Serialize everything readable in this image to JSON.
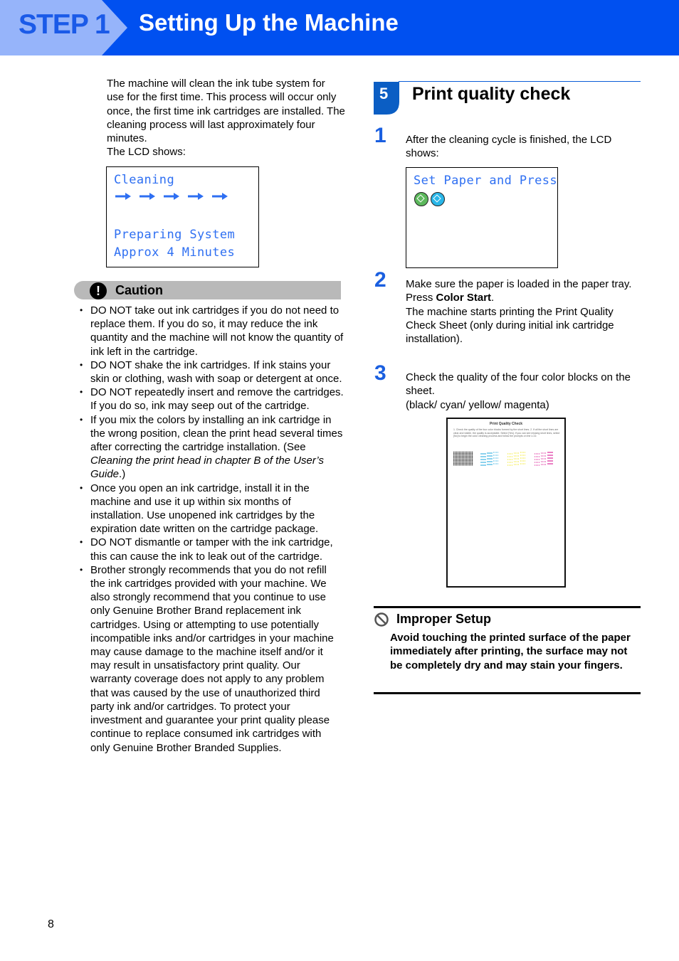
{
  "header": {
    "step_label": "STEP 1",
    "title": "Setting Up the Machine",
    "colors": {
      "banner": "#0050f0",
      "step_tab": "#96b4fa",
      "step_text": "#1a5ae8"
    }
  },
  "left": {
    "intro_lines": [
      "The machine will clean the ink tube system for use for the first time. This process will occur only once, the first time ink cartridges are installed. The cleaning process will last approximately four minutes.",
      "The LCD shows:"
    ],
    "lcd": {
      "line1": "Cleaning",
      "arrows_icon": "right-arrow-icon",
      "arrow_count": 5,
      "line3": "Preparing System",
      "line4": "Approx 4 Minutes"
    },
    "caution": {
      "icon": "exclamation-icon",
      "title": "Caution",
      "items": [
        {
          "text": "DO NOT take out ink cartridges if you do not need to replace them. If you do so, it may reduce the ink quantity and the machine will not know the quantity of ink left in the cartridge."
        },
        {
          "text": "DO NOT shake the ink cartridges. If ink stains your skin or clothing, wash with soap or detergent at once."
        },
        {
          "text": "DO NOT repeatedly insert and remove the cartridges. If you do so, ink may seep out of the cartridge."
        },
        {
          "text": "If you mix the colors by installing an ink cartridge in the wrong position, clean the print head several times after correcting the cartridge installation. (See ",
          "italic": "Cleaning the print head in chapter B of the User’s Guide",
          "suffix": ".)"
        },
        {
          "text": "Once you open an ink cartridge, install it in the machine and use it up within six months of installation. Use unopened ink cartridges by the expiration date written on the cartridge package."
        },
        {
          "text": "DO NOT dismantle or tamper with the ink cartridge, this can cause the ink to leak out of the cartridge."
        },
        {
          "text": "Brother strongly recommends that you do not refill the ink cartridges provided with your machine. We also strongly recommend that you continue to use only Genuine Brother Brand replacement ink cartridges. Using or attempting to use potentially incompatible inks and/or cartridges in your machine may cause damage to the machine itself and/or it may result in unsatisfactory print quality. Our warranty coverage does not apply to any problem that was caused by the use of unauthorized third party ink and/or cartridges. To protect your investment and guarantee your print quality please continue to replace consumed ink cartridges with only Genuine Brother Branded Supplies."
        }
      ]
    }
  },
  "right": {
    "section": {
      "number": "5",
      "title": "Print quality check"
    },
    "steps": [
      {
        "number": "1",
        "lines": [
          "After the cleaning cycle is finished, the LCD shows:"
        ]
      },
      {
        "number": "2",
        "lines": [
          "Make sure the paper is loaded in the paper tray."
        ],
        "press_prefix": "Press ",
        "press_bold": "Color Start",
        "press_suffix": ".",
        "after": "The machine starts printing the Print Quality Check Sheet (only during initial ink cartridge installation)."
      },
      {
        "number": "3",
        "lines": [
          "Check the quality of the four color blocks on the sheet.",
          "(black/ cyan/ yellow/ magenta)"
        ]
      }
    ],
    "lcd": {
      "line1": "Set Paper and Press",
      "buttons": [
        {
          "icon": "mono-start-button-icon",
          "color": "#5cb85c"
        },
        {
          "icon": "color-start-button-icon",
          "color": "#29b6e8"
        }
      ]
    },
    "sheet": {
      "title": "Print Quality Check",
      "text": "1. Check the quality of the four color blocks formed by the short lines. 2. If all the short lines are clear and visible, the quality is acceptable. Select [Yes]. If you can see missing short lines, select [No] to begin the color cleaning process and follow the prompts on the LCD.",
      "blocks": [
        {
          "name": "black",
          "color": "#000000"
        },
        {
          "name": "cyan",
          "color": "#1aa6dc"
        },
        {
          "name": "yellow",
          "color": "#f2e600"
        },
        {
          "name": "magenta",
          "color": "#d4008a"
        }
      ]
    },
    "improper": {
      "icon": "prohibited-icon",
      "title": "Improper Setup",
      "text": "Avoid touching the printed surface of the paper immediately after printing, the surface may not be completely dry and may stain your fingers."
    }
  },
  "footer": {
    "page_number": "8"
  }
}
